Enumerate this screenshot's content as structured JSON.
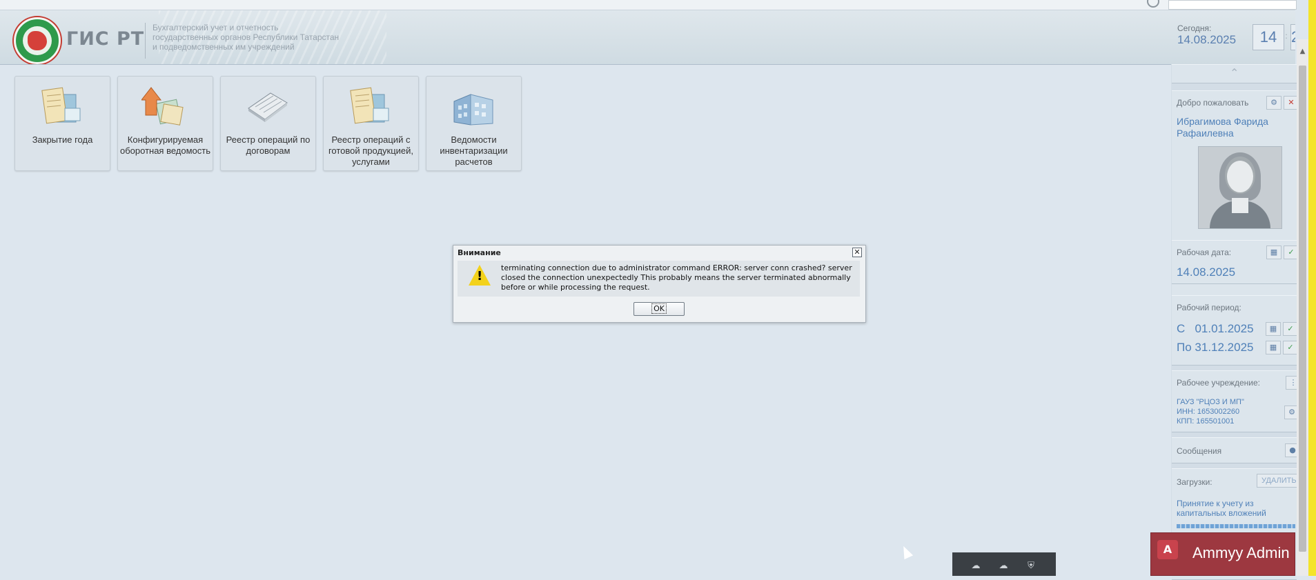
{
  "header": {
    "brand": "ГИС РТ",
    "subtitle_line1": "Бухгалтерский учет и отчетность",
    "subtitle_line2": "государственных органов Республики Татарстан",
    "subtitle_line3": "и подведомственных им учреждений",
    "today_label": "Сегодня:",
    "today_date": "14.08.2025",
    "clock_hours": "14",
    "clock_minutes_partial": "2"
  },
  "tiles": [
    {
      "label": "Закрытие года",
      "icon": "documents-icon"
    },
    {
      "label": "Конфигурируемая оборотная ведомость",
      "icon": "arrow-documents-icon"
    },
    {
      "label": "Реестр операций по договорам",
      "icon": "notebook-icon"
    },
    {
      "label": "Реестр операций с готовой продукцией, услугами",
      "icon": "documents-icon"
    },
    {
      "label": "Ведомости инвентаризации расчетов",
      "icon": "building-icon"
    }
  ],
  "right_panel": {
    "collapse_icon": "chevron-up-icon",
    "welcome_label": "Добро пожаловать",
    "user_name": "Ибрагимова Фарида Рафаилевна",
    "work_date_label": "Рабочая дата:",
    "work_date": "14.08.2025",
    "work_period_label": "Рабочий период:",
    "period_from_prefix": "С",
    "period_from": "01.01.2025",
    "period_to_prefix": "По",
    "period_to": "31.12.2025",
    "institution_label": "Рабочее учреждение:",
    "institution_name": "ГАУЗ \"РЦОЗ И МП\"",
    "institution_inn": "ИНН: 1653002260",
    "institution_kpp": "КПП: 165501001",
    "messages_label": "Сообщения",
    "downloads_label": "Загрузки:",
    "downloads_delete": "УДАЛИТЬ",
    "download_item": "Принятие к учету из капитальных вложений"
  },
  "dialog": {
    "title": "Внимание",
    "message": "terminating connection due to administrator command ERROR: server conn crashed? server closed the connection unexpectedly This probably means the server terminated abnormally before or while processing the request.",
    "ok_label": "OK"
  },
  "taskbar": {
    "ammyy_label": "Ammyy Admin"
  },
  "colors": {
    "accent_blue": "#4f80b8",
    "background": "#dde6ee",
    "ammyy_red": "#9d3840",
    "yellow_border": "#f4e42a"
  }
}
